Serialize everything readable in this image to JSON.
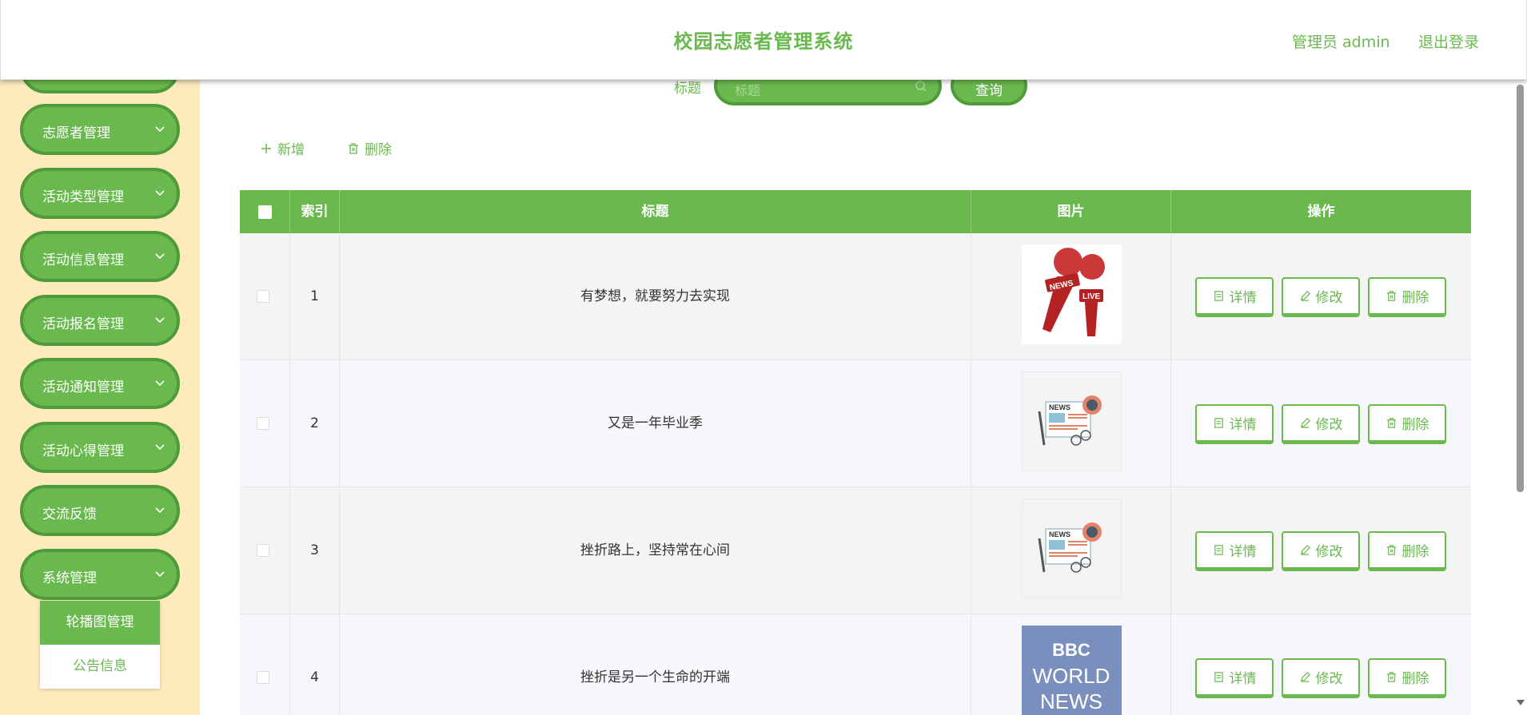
{
  "header": {
    "title": "校园志愿者管理系统",
    "user": "管理员 admin",
    "logout": "退出登录"
  },
  "sidebar": {
    "items": [
      {
        "label": "志愿者管理"
      },
      {
        "label": "活动类型管理"
      },
      {
        "label": "活动信息管理"
      },
      {
        "label": "活动报名管理"
      },
      {
        "label": "活动通知管理"
      },
      {
        "label": "活动心得管理"
      },
      {
        "label": "交流反馈"
      },
      {
        "label": "系统管理"
      }
    ],
    "submenu": [
      {
        "label": "轮播图管理",
        "active": true
      },
      {
        "label": "公告信息",
        "active": false
      }
    ]
  },
  "search": {
    "label": "标题",
    "placeholder": "标题",
    "button": "查询"
  },
  "toolbar": {
    "add_label": "新增",
    "delete_label": "删除"
  },
  "table": {
    "headers": {
      "index": "索引",
      "title": "标题",
      "image": "图片",
      "actions": "操作"
    },
    "rows": [
      {
        "index": "1",
        "title": "有梦想，就要努力去实现",
        "image": "news-live-microphones"
      },
      {
        "index": "2",
        "title": "又是一年毕业季",
        "image": "news-newspaper"
      },
      {
        "index": "3",
        "title": "挫折路上，坚持常在心间",
        "image": "news-newspaper"
      },
      {
        "index": "4",
        "title": "挫折是另一个生命的开端",
        "image": "bbc-world-news"
      }
    ],
    "actions": {
      "detail": "详情",
      "edit": "修改",
      "delete": "删除"
    }
  },
  "image_text": {
    "news": "NEWS",
    "live": "LIVE",
    "bbc": "BBC",
    "world": "WORLD",
    "world_news": "NEWS"
  },
  "colors": {
    "primary": "#6ab94f",
    "primary_dark": "#4f9b3a",
    "sidebar_bg": "#fdebbc"
  }
}
